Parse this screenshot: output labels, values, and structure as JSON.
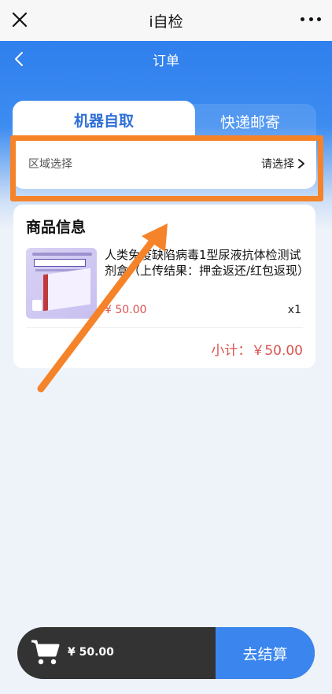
{
  "topbar": {
    "title": "i自检",
    "close_icon": "close-icon",
    "more_icon": "more-icon"
  },
  "navbar": {
    "title": "订单",
    "back_icon": "back-chevron-icon"
  },
  "tabs": [
    {
      "label": "机器自取",
      "active": true
    },
    {
      "label": "快递邮寄",
      "active": false
    }
  ],
  "region": {
    "label": "区域选择",
    "select_label": "请选择"
  },
  "goods": {
    "section_title": "商品信息",
    "name": "人类免疫缺陷病毒1型尿液抗体检测试剂盒（上传结果：押金返还/红包返现）",
    "price": "¥ 50.00",
    "qty": "x1",
    "subtotal": "小计：￥50.00"
  },
  "bottom": {
    "total": "¥ 50.00",
    "checkout_label": "去结算",
    "cart_icon": "cart-icon"
  },
  "colors": {
    "accent": "#3b86ee",
    "highlight": "#f5832a",
    "price": "#d9534f"
  }
}
